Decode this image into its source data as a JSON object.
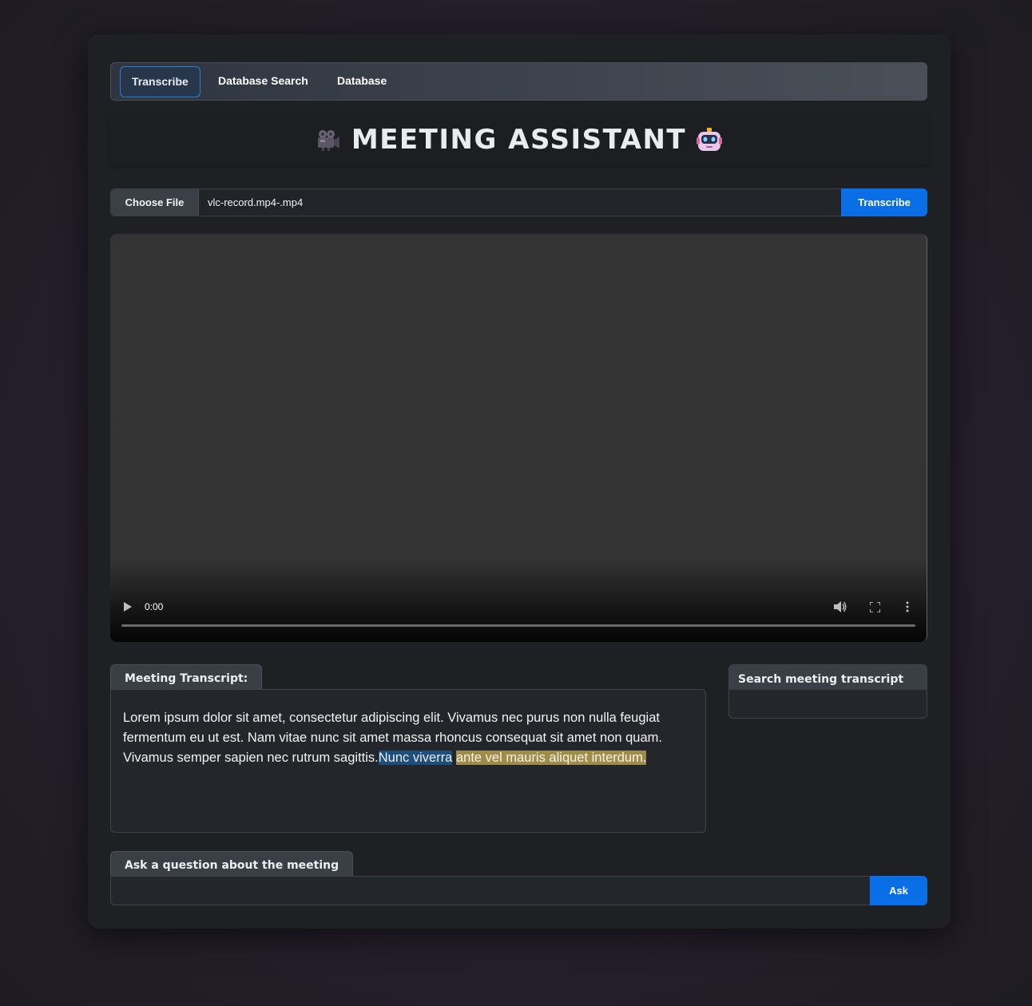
{
  "nav": {
    "tabs": [
      {
        "label": "Transcribe",
        "active": true
      },
      {
        "label": "Database Search",
        "active": false
      },
      {
        "label": "Database",
        "active": false
      }
    ]
  },
  "header": {
    "title": "MEETING ASSISTANT",
    "left_icon": "movie-camera-icon",
    "right_icon": "robot-icon"
  },
  "upload": {
    "choose_label": "Choose File",
    "file_name": "vlc-record.mp4-.mp4",
    "transcribe_label": "Transcribe"
  },
  "video": {
    "time": "0:00",
    "progress": 0
  },
  "transcript": {
    "label": "Meeting Transcript:",
    "text_plain": "Lorem ipsum dolor sit amet, consectetur adipiscing elit. Vivamus nec purus non nulla feugiat fermentum eu ut est. Nam vitae nunc sit amet massa rhoncus consequat sit amet non quam. Vivamus semper sapien nec rutrum sagittis.",
    "text_highlight_blue": "Nunc viverra",
    "text_highlight_yellow": "ante vel mauris aliquet interdum."
  },
  "search": {
    "label": "Search meeting transcript",
    "value": ""
  },
  "ask": {
    "label": "Ask a question about the meeting",
    "value": "",
    "button_label": "Ask"
  },
  "colors": {
    "accent": "#0a6ee6",
    "highlight_blue": "#1f4e7c",
    "highlight_yellow": "#a08c4a"
  }
}
